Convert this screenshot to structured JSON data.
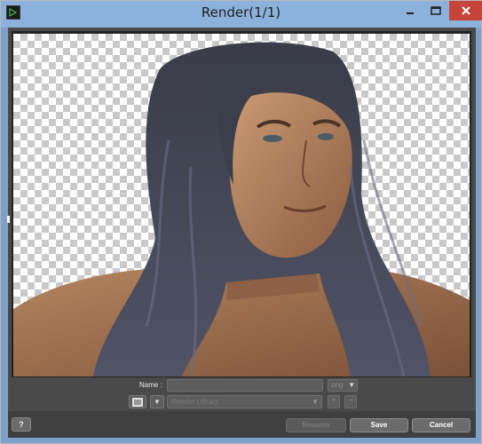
{
  "window": {
    "title": "Render(1/1)",
    "app_icon": "daz-studio-icon"
  },
  "titlebar_buttons": {
    "minimize": "minimize-icon",
    "maximize": "maximize-icon",
    "close": "close-icon"
  },
  "render": {
    "background": "transparency-checkerboard",
    "subject": "long-haired-man-portrait"
  },
  "controls": {
    "name_label": "Name :",
    "name_value": "",
    "format_value": "png",
    "destination_value": "Render Library"
  },
  "bottom": {
    "help_label": "?",
    "resume_label": "Resume",
    "save_label": "Save",
    "cancel_label": "Cancel"
  },
  "colors": {
    "titlebar": "#8cb2dc",
    "close_button": "#c7443a",
    "dialog_body": "#4a4a4a",
    "button_bar": "#3f3f3f"
  }
}
